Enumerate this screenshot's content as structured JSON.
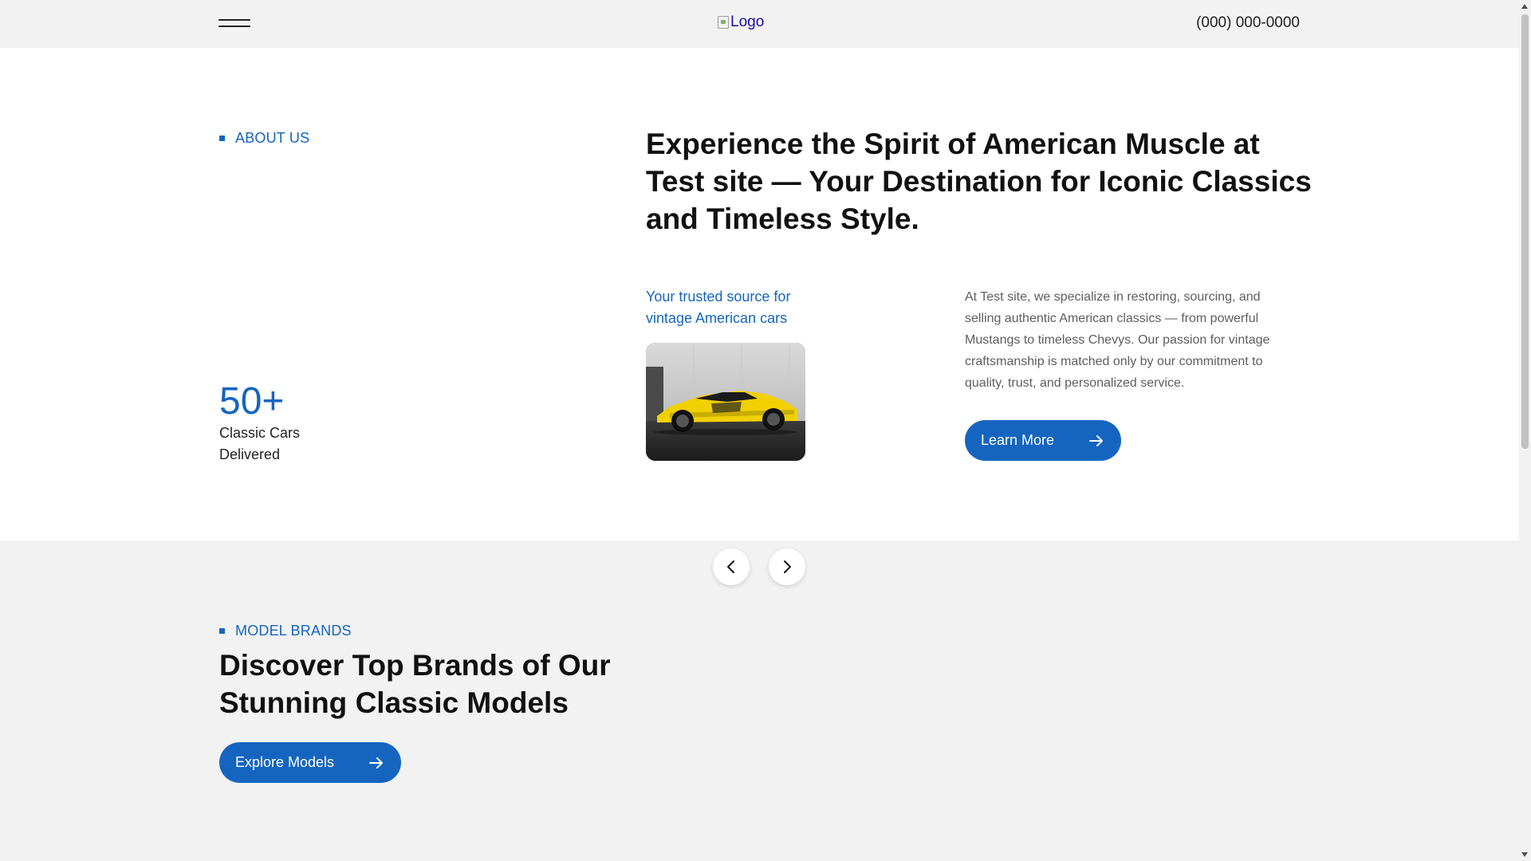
{
  "header": {
    "menu_icon": "hamburger-menu-icon",
    "logo_alt": "Logo",
    "phone": "(000) 000-0000"
  },
  "about": {
    "eyebrow": "ABOUT US",
    "headline": "Experience the Spirit of American Muscle at Test site — Your Destination for Iconic Classics and Timeless Style.",
    "tagline": "Your trusted source for vintage American cars",
    "stat_number": "50+",
    "stat_label": "Classic Cars Delivered",
    "description": "At Test site, we specialize in restoring, sourcing, and selling authentic American classics — from powerful Mustangs to timeless Chevys. Our passion for vintage craftsmanship is matched only by our commitment to quality, trust, and personalized service.",
    "cta_label": "Learn More"
  },
  "carousel": {
    "prev_icon": "chevron-left-icon",
    "next_icon": "chevron-right-icon"
  },
  "brands": {
    "eyebrow": "MODEL BRANDS",
    "title": "Discover Top Brands of Our Stunning Classic Models",
    "cta_label": "Explore Models"
  },
  "colors": {
    "accent": "#1565c0",
    "header_bg": "#f2f2f3",
    "page_bg": "#ffffff",
    "heading": "#111111",
    "body_text": "#5e5e5e"
  }
}
